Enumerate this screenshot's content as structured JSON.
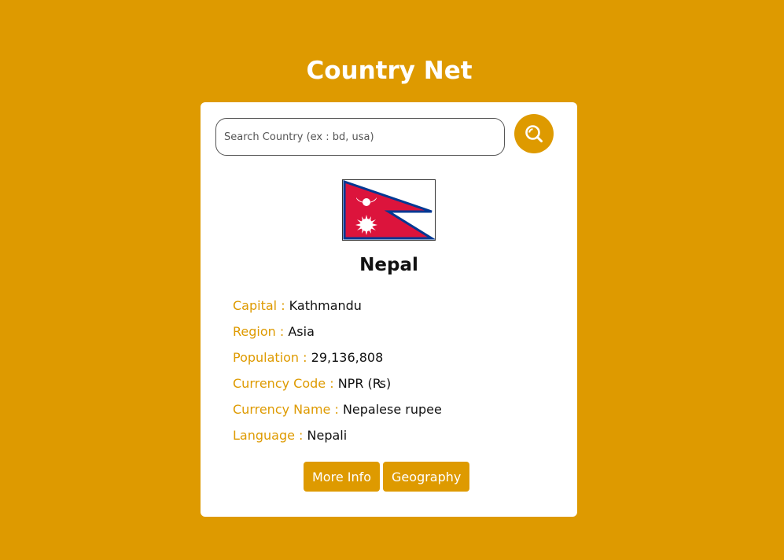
{
  "app": {
    "title": "Country Net"
  },
  "search": {
    "placeholder": "Search Country (ex : bd, usa)",
    "value": "",
    "button_icon": "search-icon"
  },
  "country": {
    "name": "Nepal",
    "flag_icon": "nepal-flag",
    "details": [
      {
        "label": "Capital :",
        "value": "Kathmandu"
      },
      {
        "label": "Region :",
        "value": "Asia"
      },
      {
        "label": "Population :",
        "value": "29,136,808"
      },
      {
        "label": "Currency Code :",
        "value": "NPR (₨)"
      },
      {
        "label": "Currency Name :",
        "value": "Nepalese rupee"
      },
      {
        "label": "Language :",
        "value": "Nepali"
      }
    ]
  },
  "actions": {
    "more_info_label": "More Info",
    "geography_label": "Geography"
  },
  "colors": {
    "accent": "#DE9A00",
    "card": "#FFFFFF",
    "flag_red": "#DC143C",
    "flag_blue": "#003893"
  }
}
